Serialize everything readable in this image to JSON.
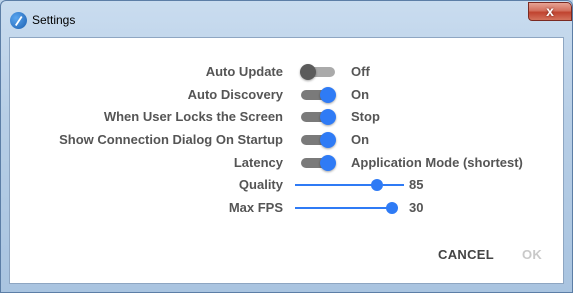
{
  "window": {
    "title": "Settings",
    "close_label": "x"
  },
  "settings": [
    {
      "label": "Auto Update",
      "state": "off",
      "value": "Off"
    },
    {
      "label": "Auto Discovery",
      "state": "on",
      "value": "On"
    },
    {
      "label": "When User Locks the Screen",
      "state": "on",
      "value": "Stop"
    },
    {
      "label": "Show Connection Dialog On Startup",
      "state": "on",
      "value": "On"
    },
    {
      "label": "Latency",
      "state": "on",
      "value": "Application Mode (shortest)"
    }
  ],
  "sliders": [
    {
      "label": "Quality",
      "value": "85",
      "level": 0.85
    },
    {
      "label": "Max FPS",
      "value": "30",
      "level": 1.0
    }
  ],
  "buttons": {
    "cancel": "CANCEL",
    "ok": "OK"
  },
  "colors": {
    "accent": "#2f7bf5",
    "label": "#555555",
    "disabled": "#c9c9c9"
  }
}
